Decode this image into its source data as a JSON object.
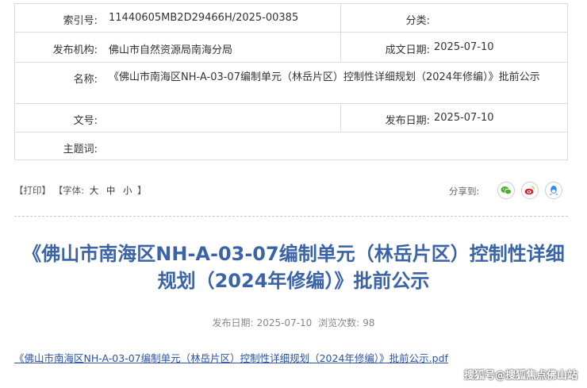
{
  "meta": {
    "index_label": "索引号:",
    "index_value": "11440605MB2D29466H/2025-00385",
    "category_label": "分类:",
    "category_value": "",
    "org_label": "发布机构:",
    "org_value": "佛山市自然资源局南海分局",
    "created_label": "成文日期:",
    "created_value": "2025-07-10",
    "name_label": "名称:",
    "name_value": "《佛山市南海区NH-A-03-07编制单元（林岳片区）控制性详细规划（2024年修编）》批前公示",
    "docno_label": "文号:",
    "docno_value": "",
    "published_label": "发布日期:",
    "published_value": "2025-07-10",
    "subject_label": "主题词:",
    "subject_value": ""
  },
  "toolbar": {
    "print": "【打印】",
    "font_label": "【字体:",
    "font_large": "大",
    "font_medium": "中",
    "font_small": "小",
    "font_close": "】",
    "share_label": "分享到:",
    "share_icons": [
      "wechat-icon",
      "weibo-icon",
      "qq-icon"
    ],
    "colors": {
      "wechat": "#4bb02f",
      "weibo": "#e6162d",
      "qq": "#2d8cf0"
    }
  },
  "article": {
    "title": "《佛山市南海区NH-A-03-07编制单元（林岳片区）控制性详细规划（2024年修编）》批前公示",
    "pub_date_label": "发布日期:",
    "pub_date": "2025-07-10",
    "views_label": "浏览次数:",
    "views": "98",
    "attachment": "《佛山市南海区NH-A-03-07编制单元（林岳片区）控制性详细规划（2024年修编）》批前公示.pdf",
    "title_color": "#3a63a8",
    "link_color": "#2b52a6"
  },
  "watermark": "搜狐号@搜狐焦点佛山站"
}
